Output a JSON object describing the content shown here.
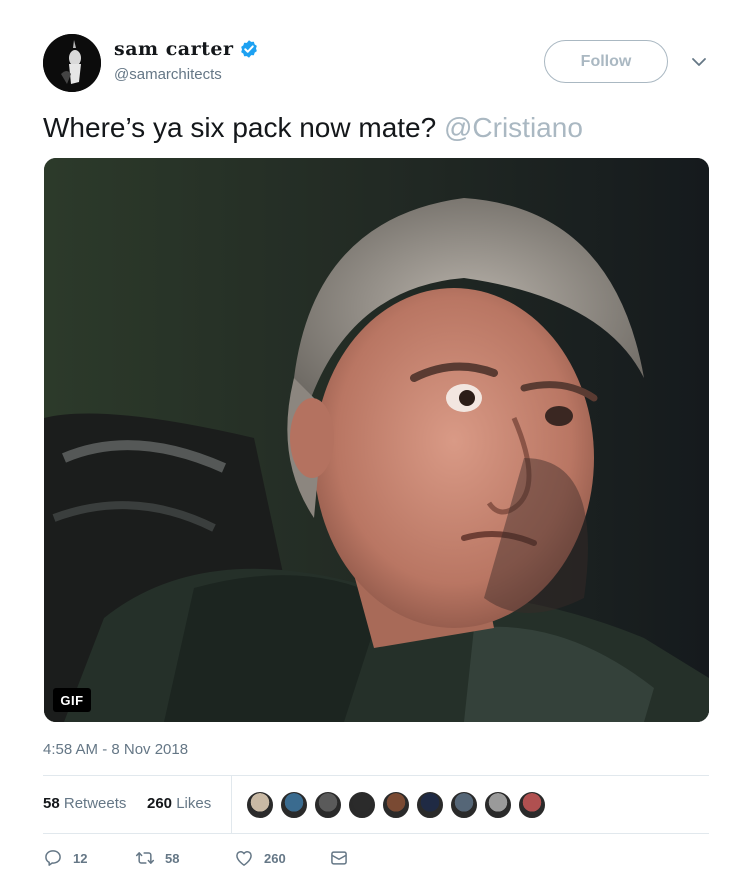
{
  "user": {
    "display_name": "sam carter",
    "handle": "@samarchitects",
    "verified": true,
    "avatar_icon": "avatar-photo"
  },
  "follow": {
    "label": "Follow"
  },
  "tweet": {
    "text": "Where’s ya six pack now mate?",
    "mention": "@Cristiano"
  },
  "media": {
    "badge": "GIF",
    "description_icon": "gif-media"
  },
  "timestamp": "4:58 AM - 8 Nov 2018",
  "stats": {
    "retweets_count": "58",
    "retweets_label": "Retweets",
    "likes_count": "260",
    "likes_label": "Likes"
  },
  "liker_avatar_colors": [
    "#c9b9a4",
    "#3a6b8f",
    "#5a5a5a",
    "#2b2b2b",
    "#7a4a33",
    "#1f2a44",
    "#556677",
    "#9a9a9a",
    "#b05050"
  ],
  "actions": {
    "reply_count": "12",
    "retweet_count": "58",
    "like_count": "260"
  },
  "colors": {
    "text": "#14171a",
    "secondary": "#657786",
    "mention": "#aab8c2",
    "verified": "#1da1f2",
    "divider": "#e1e8ed"
  }
}
